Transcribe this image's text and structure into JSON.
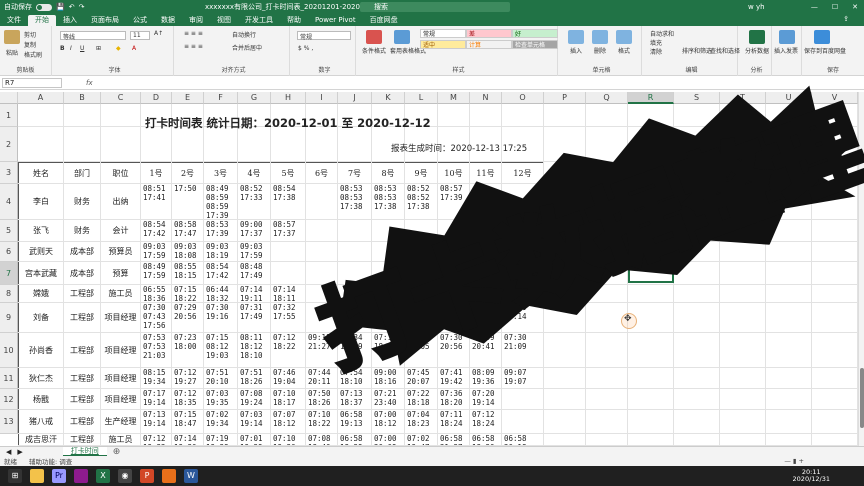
{
  "titlebar": {
    "autosave_label": "自动保存",
    "document_title": "xxxxxxx有限公司_打卡时间表_20201201-20201213.xlsx",
    "search_placeholder": "搜索",
    "user": "w yh"
  },
  "menu": {
    "tabs": [
      "文件",
      "开始",
      "插入",
      "页面布局",
      "公式",
      "数据",
      "审阅",
      "视图",
      "开发工具",
      "帮助",
      "Power Pivot",
      "百度网盘"
    ],
    "active": "开始"
  },
  "ribbon": {
    "clipboard": {
      "label": "剪贴板",
      "paste": "粘贴",
      "cut": "剪切",
      "copy": "复制",
      "format_painter": "格式刷"
    },
    "font": {
      "label": "字体",
      "font_name": "等线",
      "font_size": "11"
    },
    "alignment": {
      "label": "对齐方式",
      "wrap": "自动换行",
      "merge": "合并后居中"
    },
    "number": {
      "label": "数字",
      "format": "常规"
    },
    "styles": {
      "label": "样式",
      "conditional": "条件格式",
      "table": "套用表格格式",
      "normal": "常规",
      "bad": "差",
      "good": "好",
      "neutral": "适中",
      "calc": "计算",
      "check": "检查单元格"
    },
    "cells": {
      "label": "单元格",
      "insert": "插入",
      "delete": "删除",
      "format": "格式"
    },
    "editing": {
      "label": "编辑",
      "autosum": "自动求和",
      "fill": "填充",
      "clear": "清除",
      "sort": "排序和筛选",
      "find": "查找和选择"
    },
    "analysis": {
      "label": "分析",
      "analyze": "分析数据"
    },
    "invoice": {
      "insert": "插入发票"
    },
    "save": {
      "label": "保存",
      "save_to": "保存到百度网盘"
    },
    "colors": {
      "excel_green": "#217346",
      "bad_bg": "#ffc7ce",
      "good_bg": "#c6efce",
      "neutral_bg": "#ffeb9c",
      "check_bg": "#a5a5a5"
    }
  },
  "formula_bar": {
    "name_box": "R7",
    "fx": "fx",
    "value": ""
  },
  "columns": [
    "A",
    "B",
    "C",
    "D",
    "E",
    "F",
    "G",
    "H",
    "I",
    "J",
    "K",
    "L",
    "M",
    "N",
    "O",
    "P",
    "Q",
    "R",
    "S",
    "T",
    "U",
    "V"
  ],
  "selected_column": "R",
  "rows": [
    "1",
    "2",
    "3",
    "4",
    "5",
    "6",
    "7",
    "8",
    "9",
    "10",
    "11",
    "12",
    "13"
  ],
  "selected_row": "7",
  "sheet": {
    "title": "打卡时间表 统计日期：2020-12-01 至 2020-12-12",
    "generated": "报表生成时间：2020-12-13 17:25",
    "headers": [
      "姓名",
      "部门",
      "职位",
      "1号",
      "2号",
      "3号",
      "4号",
      "5号",
      "6号",
      "7号",
      "8号",
      "9号",
      "10号",
      "11号",
      "12号"
    ],
    "employees": [
      {
        "name": "李白",
        "dept": "财务",
        "role": "出纳",
        "times": [
          "08:51\n17:41",
          "17:50",
          "08:49\n08:59\n08:59\n17:39",
          "08:52\n17:33",
          "08:54\n17:38",
          "",
          "08:53\n08:53\n17:38",
          "08:53\n08:53\n17:38",
          "08:52\n08:52\n17:38",
          "08:57\n17:39",
          "",
          ""
        ]
      },
      {
        "name": "张飞",
        "dept": "财务",
        "role": "会计",
        "times": [
          "08:54\n17:42",
          "08:58\n17:47",
          "08:53\n17:39",
          "09:00\n17:37",
          "08:57\n17:37",
          "",
          "",
          "",
          "",
          "",
          "",
          ""
        ]
      },
      {
        "name": "武则天",
        "dept": "成本部",
        "role": "预算员",
        "times": [
          "09:03\n17:59",
          "09:03\n18:08",
          "09:03\n18:19",
          "09:03\n17:59",
          "",
          "",
          "",
          "",
          "",
          "",
          "",
          ""
        ]
      },
      {
        "name": "宫本武藏",
        "dept": "成本部",
        "role": "预算",
        "times": [
          "08:49\n17:59",
          "08:55\n18:15",
          "08:54\n17:42",
          "08:48\n17:49",
          "",
          "",
          "",
          "",
          "",
          "",
          "08:53\n18:16",
          "08:53\n18:20"
        ]
      },
      {
        "name": "嫦娥",
        "dept": "工程部",
        "role": "施工员",
        "times": [
          "06:55\n18:36",
          "07:15\n18:22",
          "06:44\n18:32",
          "07:14\n19:11",
          "07:14\n18:11",
          "",
          "",
          "",
          "",
          "07:17\n18:11",
          "07:18\n18:47",
          "06:56\n20:08"
        ]
      },
      {
        "name": "刘备",
        "dept": "工程部",
        "role": "项目经理",
        "times": [
          "07:30\n07:43\n17:56",
          "07:29\n20:56",
          "07:30\n19:16",
          "07:31\n17:49",
          "07:32\n17:55",
          "",
          "",
          "",
          "07:29\n19:49",
          "07:32\n21:37",
          "07:35\n22:11",
          "07:30\n19:14"
        ]
      },
      {
        "name": "孙尚香",
        "dept": "工程部",
        "role": "项目经理",
        "times": [
          "07:53\n07:53\n21:03",
          "07:23\n18:00",
          "07:15\n08:12\n19:03",
          "08:11\n18:12\n18:10",
          "07:12\n18:22",
          "09:11\n21:27",
          "07:34\n18:39",
          "07:19\n18:20",
          "07:33\n23:05",
          "07:30\n20:56",
          "07:39\n20:41",
          "07:30\n21:09"
        ]
      },
      {
        "name": "狄仁杰",
        "dept": "工程部",
        "role": "项目经理",
        "times": [
          "08:15\n19:34",
          "07:12\n19:27",
          "07:51\n20:10",
          "07:51\n18:26",
          "07:46\n19:04",
          "07:44\n20:11",
          "07:54\n18:10",
          "09:00\n18:16",
          "07:45\n20:07",
          "07:41\n19:42",
          "08:09\n19:36",
          "09:07\n19:07"
        ]
      },
      {
        "name": "杨戬",
        "dept": "工程部",
        "role": "项目经理",
        "times": [
          "07:17\n19:14",
          "07:12\n18:35",
          "07:03\n19:35",
          "07:08\n19:24",
          "07:10\n18:17",
          "07:50\n18:26",
          "07:13\n18:37",
          "07:21\n23:40",
          "07:22\n18:18",
          "07:36\n18:20",
          "07:20\n19:14",
          ""
        ]
      },
      {
        "name": "猪八戒",
        "dept": "工程部",
        "role": "生产经理",
        "times": [
          "07:13\n19:14",
          "07:15\n18:47",
          "07:02\n19:34",
          "07:03\n19:14",
          "07:07\n18:12",
          "07:10\n18:22",
          "06:58\n19:13",
          "07:00\n18:12",
          "07:04\n18:23",
          "07:11\n18:24",
          "07:12\n18:24",
          ""
        ]
      },
      {
        "name": "成吉思汗",
        "dept": "工程部",
        "role": "施工员",
        "times": [
          "07:12\n19:32",
          "07:14\n19:30",
          "07:19\n19:38",
          "07:01\n19:29",
          "07:10\n19:36",
          "07:08\n18:40",
          "06:58\n18:29",
          "07:00\n20:09",
          "07:02\n19:47",
          "06:58\n21:27",
          "06:58\n18:20",
          "06:58\n20:18"
        ]
      }
    ]
  },
  "overlay_text": "打卡数据整理",
  "sheet_tab": "打卡时间",
  "status": {
    "ready": "就绪",
    "accessibility": "辅助功能: 调查"
  },
  "clock": {
    "time": "20:11",
    "date": "2020/12/31"
  }
}
